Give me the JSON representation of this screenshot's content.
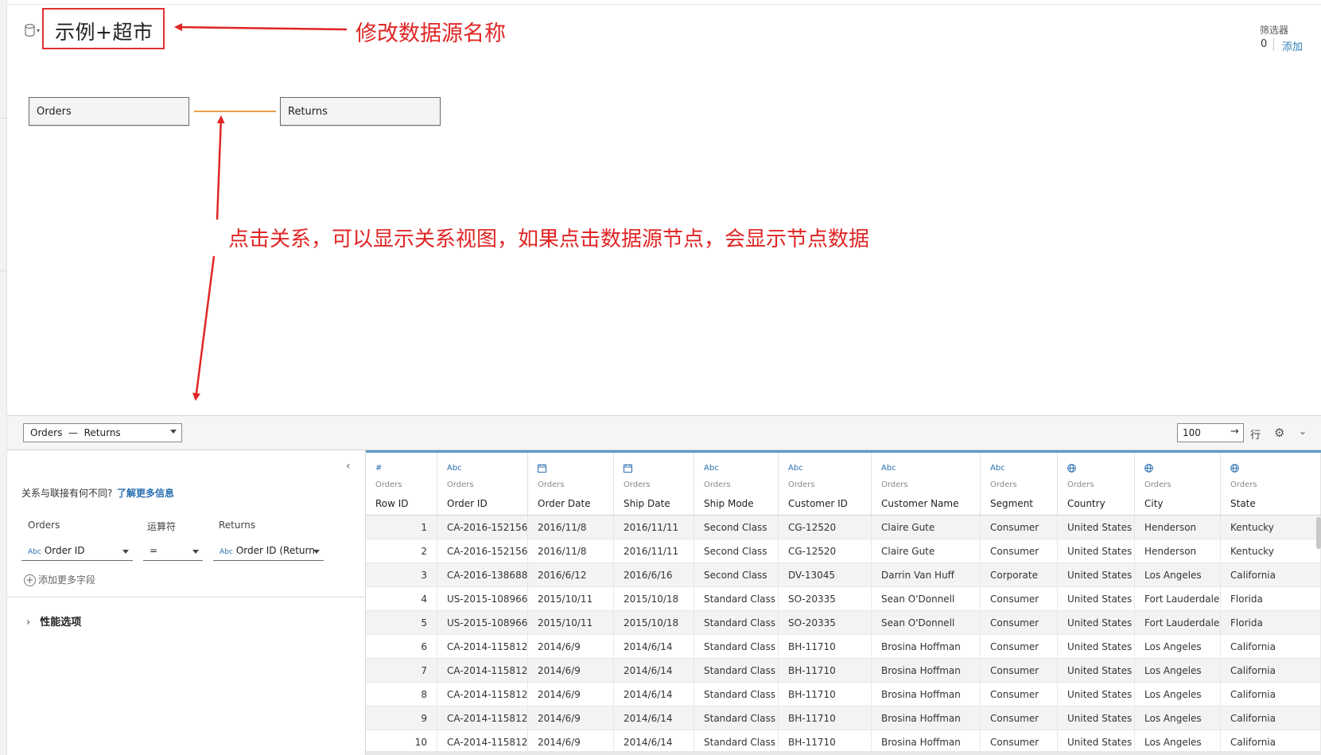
{
  "datasource": {
    "name": "示例+超市"
  },
  "annotations": {
    "rename_hint": "修改数据源名称",
    "relation_hint": "点击关系，可以显示关系视图，如果点击数据源节点，会显示节点数据"
  },
  "filter": {
    "label": "筛选器",
    "count": "0",
    "add": "添加"
  },
  "canvas": {
    "left_table": "Orders",
    "right_table": "Returns"
  },
  "toolbar": {
    "relation_select": "Orders  —  Returns",
    "rows_value": "100",
    "rows_go": "→",
    "rows_label": "行"
  },
  "panel": {
    "collapse": "‹",
    "diff_question": "关系与联接有何不同?",
    "diff_link": "了解更多信息",
    "col_left": "Orders",
    "col_op": "运算符",
    "col_right": "Returns",
    "abc": "Abc",
    "left_field": "Order ID",
    "operator": "=",
    "right_field": "Order ID (Return",
    "add_field": "添加更多字段",
    "perf": "性能选项"
  },
  "grid": {
    "columns": [
      {
        "icon": "#",
        "source": "Orders",
        "name": "Row ID"
      },
      {
        "icon": "Abc",
        "source": "Orders",
        "name": "Order ID"
      },
      {
        "icon": "cal",
        "source": "Orders",
        "name": "Order Date"
      },
      {
        "icon": "cal",
        "source": "Orders",
        "name": "Ship Date"
      },
      {
        "icon": "Abc",
        "source": "Orders",
        "name": "Ship Mode"
      },
      {
        "icon": "Abc",
        "source": "Orders",
        "name": "Customer ID"
      },
      {
        "icon": "Abc",
        "source": "Orders",
        "name": "Customer Name"
      },
      {
        "icon": "Abc",
        "source": "Orders",
        "name": "Segment"
      },
      {
        "icon": "globe",
        "source": "Orders",
        "name": "Country"
      },
      {
        "icon": "globe",
        "source": "Orders",
        "name": "City"
      },
      {
        "icon": "globe",
        "source": "Orders",
        "name": "State"
      }
    ],
    "rows": [
      [
        "1",
        "CA-2016-152156",
        "2016/11/8",
        "2016/11/11",
        "Second Class",
        "CG-12520",
        "Claire Gute",
        "Consumer",
        "United States",
        "Henderson",
        "Kentucky"
      ],
      [
        "2",
        "CA-2016-152156",
        "2016/11/8",
        "2016/11/11",
        "Second Class",
        "CG-12520",
        "Claire Gute",
        "Consumer",
        "United States",
        "Henderson",
        "Kentucky"
      ],
      [
        "3",
        "CA-2016-138688",
        "2016/6/12",
        "2016/6/16",
        "Second Class",
        "DV-13045",
        "Darrin Van Huff",
        "Corporate",
        "United States",
        "Los Angeles",
        "California"
      ],
      [
        "4",
        "US-2015-108966",
        "2015/10/11",
        "2015/10/18",
        "Standard Class",
        "SO-20335",
        "Sean O'Donnell",
        "Consumer",
        "United States",
        "Fort Lauderdale",
        "Florida"
      ],
      [
        "5",
        "US-2015-108966",
        "2015/10/11",
        "2015/10/18",
        "Standard Class",
        "SO-20335",
        "Sean O'Donnell",
        "Consumer",
        "United States",
        "Fort Lauderdale",
        "Florida"
      ],
      [
        "6",
        "CA-2014-115812",
        "2014/6/9",
        "2014/6/14",
        "Standard Class",
        "BH-11710",
        "Brosina Hoffman",
        "Consumer",
        "United States",
        "Los Angeles",
        "California"
      ],
      [
        "7",
        "CA-2014-115812",
        "2014/6/9",
        "2014/6/14",
        "Standard Class",
        "BH-11710",
        "Brosina Hoffman",
        "Consumer",
        "United States",
        "Los Angeles",
        "California"
      ],
      [
        "8",
        "CA-2014-115812",
        "2014/6/9",
        "2014/6/14",
        "Standard Class",
        "BH-11710",
        "Brosina Hoffman",
        "Consumer",
        "United States",
        "Los Angeles",
        "California"
      ],
      [
        "9",
        "CA-2014-115812",
        "2014/6/9",
        "2014/6/14",
        "Standard Class",
        "BH-11710",
        "Brosina Hoffman",
        "Consumer",
        "United States",
        "Los Angeles",
        "California"
      ],
      [
        "10",
        "CA-2014-115812",
        "2014/6/9",
        "2014/6/14",
        "Standard Class",
        "BH-11710",
        "Brosina Hoffman",
        "Consumer",
        "United States",
        "Los Angeles",
        "California"
      ]
    ]
  },
  "colors": {
    "annotation": "#e02525",
    "noodle": "#e8a04a",
    "link": "#2a6fb0"
  }
}
